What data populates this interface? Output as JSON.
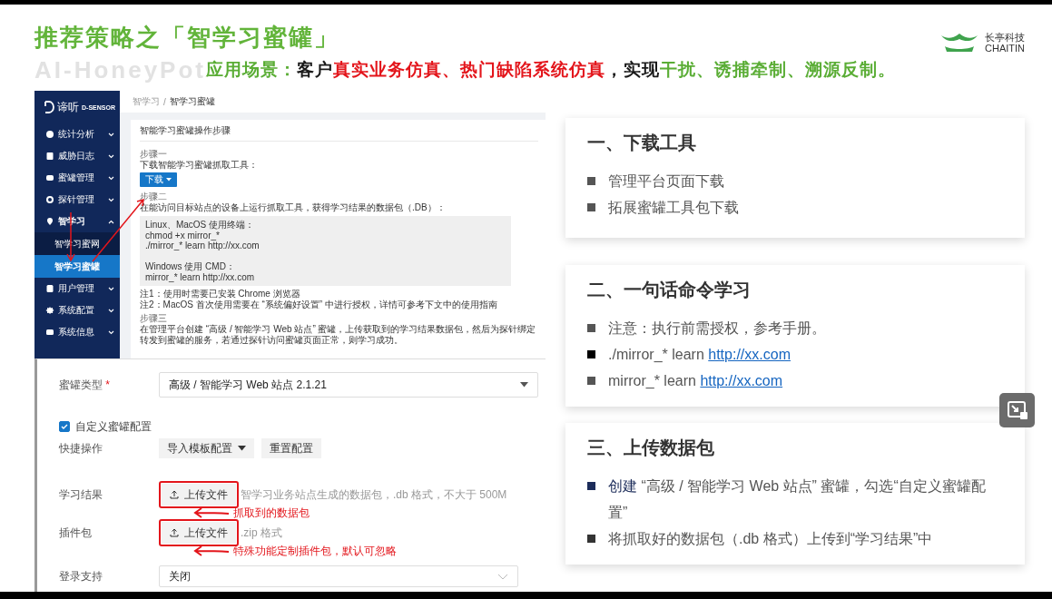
{
  "slide": {
    "title": "推荐策略之「智学习蜜罐」",
    "subtitle_en": "AI-HoneyPot",
    "subtitle_parts": [
      {
        "text": "应用场景：",
        "color": "#5aad35"
      },
      {
        "text": "客户",
        "color": "#1a1a1a"
      },
      {
        "text": "真实业务仿真、热门缺陷系统仿真",
        "color": "#e3151b"
      },
      {
        "text": "，实现",
        "color": "#1a1a1a"
      },
      {
        "text": "干扰、诱捕牵制、溯源反制。",
        "color": "#5aad35"
      }
    ],
    "logo": {
      "cn": "长亭科技",
      "en": "CHAITIN"
    }
  },
  "app_screenshot": {
    "brand": {
      "cn": "谛听",
      "en": "D-SENSOR"
    },
    "sidebar": [
      {
        "label": "统计分析",
        "expanded": false
      },
      {
        "label": "威胁日志",
        "expanded": false
      },
      {
        "label": "蜜罐管理",
        "expanded": false
      },
      {
        "label": "探针管理",
        "expanded": false
      },
      {
        "label": "智学习",
        "expanded": true,
        "children": [
          {
            "label": "智学习蜜网",
            "selected": false
          },
          {
            "label": "智学习蜜罐",
            "selected": true
          }
        ]
      },
      {
        "label": "用户管理",
        "expanded": false
      },
      {
        "label": "系统配置",
        "expanded": false
      },
      {
        "label": "系统信息",
        "expanded": false
      }
    ],
    "breadcrumb": [
      "智学习",
      "智学习蜜罐"
    ],
    "breadcrumb_separator": "/",
    "card_title": "智能学习蜜罐操作步骤",
    "step1": {
      "label": "步骤一",
      "text": "下载智能学习蜜罐抓取工具：",
      "button": "下载"
    },
    "step2": {
      "label": "步骤二",
      "text": "在能访问目标站点的设备上运行抓取工具，获得学习结果的数据包（.DB）：",
      "code": [
        [
          "Linux、MacOS 使用终端：",
          "chmod +x mirror_*",
          "./mirror_* learn http://xx.com"
        ],
        [
          "Windows 使用 CMD：",
          "mirror_* learn http://xx.com"
        ]
      ]
    },
    "notes": [
      "注1：使用时需要已安装 Chrome 浏览器",
      "注2：MacOS 首次使用需要在 “系统偏好设置” 中进行授权，详情可参考下文中的使用指南"
    ],
    "step3": {
      "label": "步骤三",
      "text": "在管理平台创建 “高级 / 智能学习 Web 站点” 蜜罐，上传获取到的学习结果数据包，然后为探针绑定转发到蜜罐的服务，若通过探针访问蜜罐页面正常，则学习成功。"
    }
  },
  "form": {
    "rows": [
      {
        "kind": "select",
        "label": "蜜罐类型",
        "required": true,
        "required_mark": "*",
        "value": "高级 / 智能学习 Web 站点 2.1.21"
      },
      {
        "kind": "checkbox",
        "label": "自定义蜜罐配置",
        "checked": true
      },
      {
        "kind": "actions",
        "label": "快捷操作",
        "buttons": [
          "导入模板配置",
          "重置配置"
        ]
      },
      {
        "kind": "upload",
        "label": "学习结果",
        "button": "上传文件",
        "hint": "智学习业务站点生成的数据包，.db 格式，不大于 500M",
        "note": "抓取到的数据包"
      },
      {
        "kind": "upload",
        "label": "插件包",
        "button": "上传文件",
        "hint": ".zip 格式",
        "note": "特殊功能定制插件包，默认可忽略"
      },
      {
        "kind": "dropdown",
        "label": "登录支持",
        "value": "关闭"
      }
    ]
  },
  "cards": [
    {
      "title": "一、下载工具",
      "items": [
        {
          "text": "管理平台页面下载",
          "color": "#555555"
        },
        {
          "text": "拓展蜜罐工具包下载",
          "color": "#555555"
        }
      ]
    },
    {
      "title": "二、一句话命令学习",
      "items": [
        {
          "text": "注意：执行前需授权，参考手册。",
          "color": "#555555"
        },
        {
          "text": "./mirror_* learn",
          "link": "http://xx.com",
          "color": "#000000"
        },
        {
          "text": "mirror_* learn",
          "link": "http://xx.com",
          "color": "#555555"
        }
      ]
    },
    {
      "title": "三、上传数据包",
      "items": [
        {
          "lead": "创建",
          "text": "“高级 / 智能学习 Web 站点” 蜜罐，勾选“自定义蜜罐配置”",
          "color": "#1c2c5a"
        },
        {
          "text": "将抓取好的数据包（.db 格式）上传到“学习结果”中",
          "color": "#333333"
        }
      ]
    }
  ]
}
